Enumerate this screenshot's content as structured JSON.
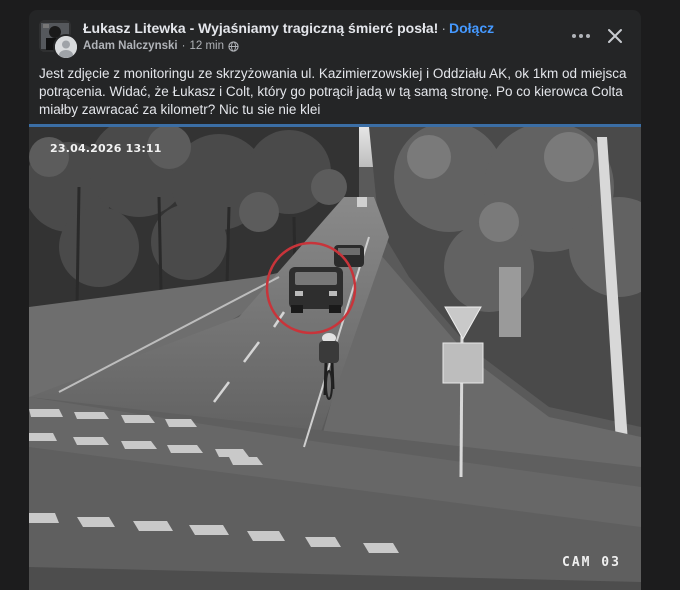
{
  "post": {
    "group_name": "Łukasz Litewka - Wyjaśniamy tragiczną śmierć posła!",
    "join_label": "Dołącz",
    "author": "Adam Nalczynski",
    "time": "12 min",
    "text": "Jest zdjęcie z monitoringu ze skrzyżowania ul. Kazimierzowskiej i Oddziału AK, ok 1km od miejsca potrącenia. Widać, że Łukasz i Colt, który go potrącił jadą w tą samą stronę. Po co kierowca Colta miałby zawracać za kilometr? Nic tu sie nie klei"
  },
  "image": {
    "timestamp": "23.04.2026 13:11",
    "camera_label": "CAM 03"
  },
  "icons": {
    "more": "more-horizontal-icon",
    "close": "close-icon",
    "privacy": "globe-icon"
  },
  "colors": {
    "background": "#1c1c1d",
    "card": "#242526",
    "text_primary": "#e4e6eb",
    "text_secondary": "#b0b3b8",
    "link": "#4599ff",
    "highlight_circle": "#c8343a"
  }
}
